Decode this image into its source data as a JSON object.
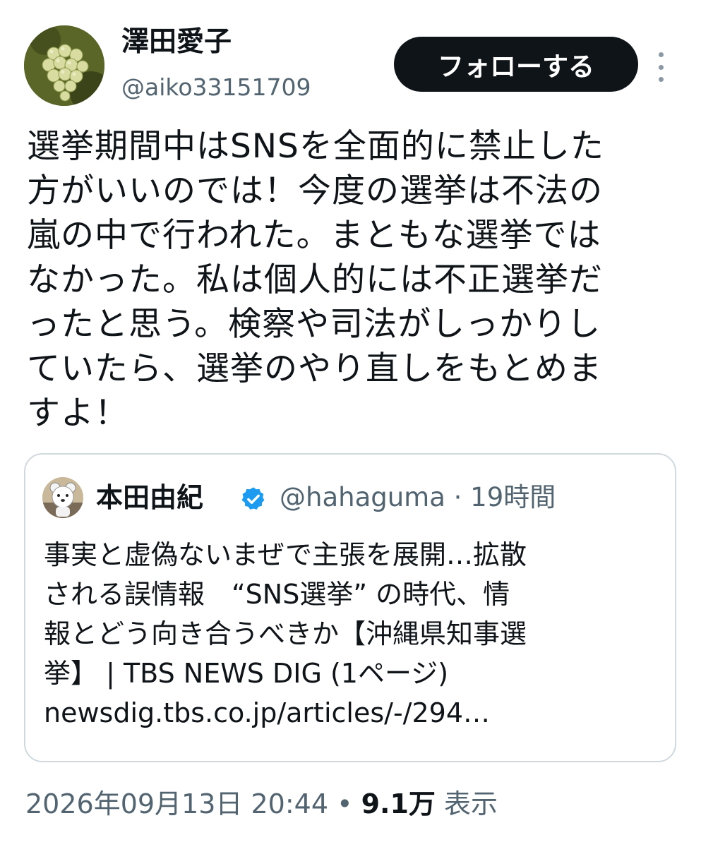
{
  "author": {
    "display_name": "澤田愛子",
    "handle": "@aiko33151709"
  },
  "follow_button": {
    "label": "フォローする"
  },
  "more_button": {
    "icon": "more-vertical-icon"
  },
  "tweet": {
    "text": "選挙期間中はSNSを全面的に禁止した\n方がいいのでは！今度の選挙は不法の\n嵐の中で行われた。まともな選挙では\nなかった。私は個人的には不正選挙だ\nったと思う。検察や司法がしっかりし\nていたら、選挙のやり直しをもとめま\nすよ！"
  },
  "quoted_tweet": {
    "display_name": "本田由紀",
    "verified": true,
    "handle_time": "@hahaguma · 19時間",
    "text": "事実と虚偽ないまぜで主張を展開…拡散\nされる誤情報　“SNS選挙” の時代、情\n報とどう向き合うべきか【沖縄県知事選\n挙】 | TBS NEWS DIG (1ページ)\nnewsdig.tbs.co.jp/articles/-/294…"
  },
  "meta": {
    "timestamp": "2026年09月13日 20:44",
    "separator": " • ",
    "views_count": "9.1万",
    "views_label": " 表示"
  },
  "colors": {
    "text_primary": "#0f1419",
    "text_secondary": "#536471",
    "border": "#cfd9de",
    "verified_blue": "#1d9bf0",
    "button_bg": "#0f1419"
  }
}
